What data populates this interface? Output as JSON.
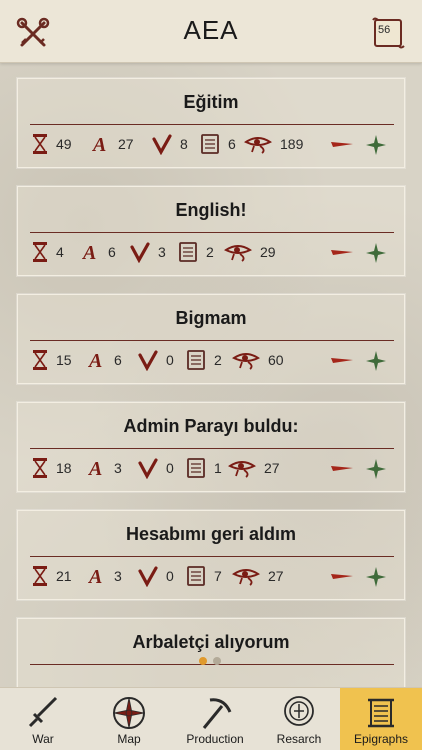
{
  "header": {
    "title": "AEA",
    "scroll_badge": "56"
  },
  "cards": [
    {
      "title": "Eğitim",
      "hourglass": "49",
      "letter": "27",
      "check": "8",
      "tablet": "6",
      "eye": "189"
    },
    {
      "title": "English!",
      "hourglass": "4",
      "letter": "6",
      "check": "3",
      "tablet": "2",
      "eye": "29"
    },
    {
      "title": "Bigmam",
      "hourglass": "15",
      "letter": "6",
      "check": "0",
      "tablet": "2",
      "eye": "60"
    },
    {
      "title": "Admin Parayı buldu:",
      "hourglass": "18",
      "letter": "3",
      "check": "0",
      "tablet": "1",
      "eye": "27"
    },
    {
      "title": "Hesabımı geri aldım",
      "hourglass": "21",
      "letter": "3",
      "check": "0",
      "tablet": "7",
      "eye": "27"
    },
    {
      "title": "Arbaletçi alıyorum",
      "hourglass": "",
      "letter": "",
      "check": "",
      "tablet": "",
      "eye": ""
    }
  ],
  "tabs": [
    {
      "label": "War",
      "icon": "sword-icon"
    },
    {
      "label": "Map",
      "icon": "compass-icon"
    },
    {
      "label": "Production",
      "icon": "pickaxe-icon"
    },
    {
      "label": "Resarch",
      "icon": "research-icon"
    },
    {
      "label": "Epigraphs",
      "icon": "scroll-icon"
    }
  ],
  "colors": {
    "accent": "#f0c24f",
    "dark_red": "#7a1c14",
    "rune_green": "#3f6b3a",
    "dot_active": "#e09a2d",
    "dot_inactive": "#b3aa98"
  }
}
